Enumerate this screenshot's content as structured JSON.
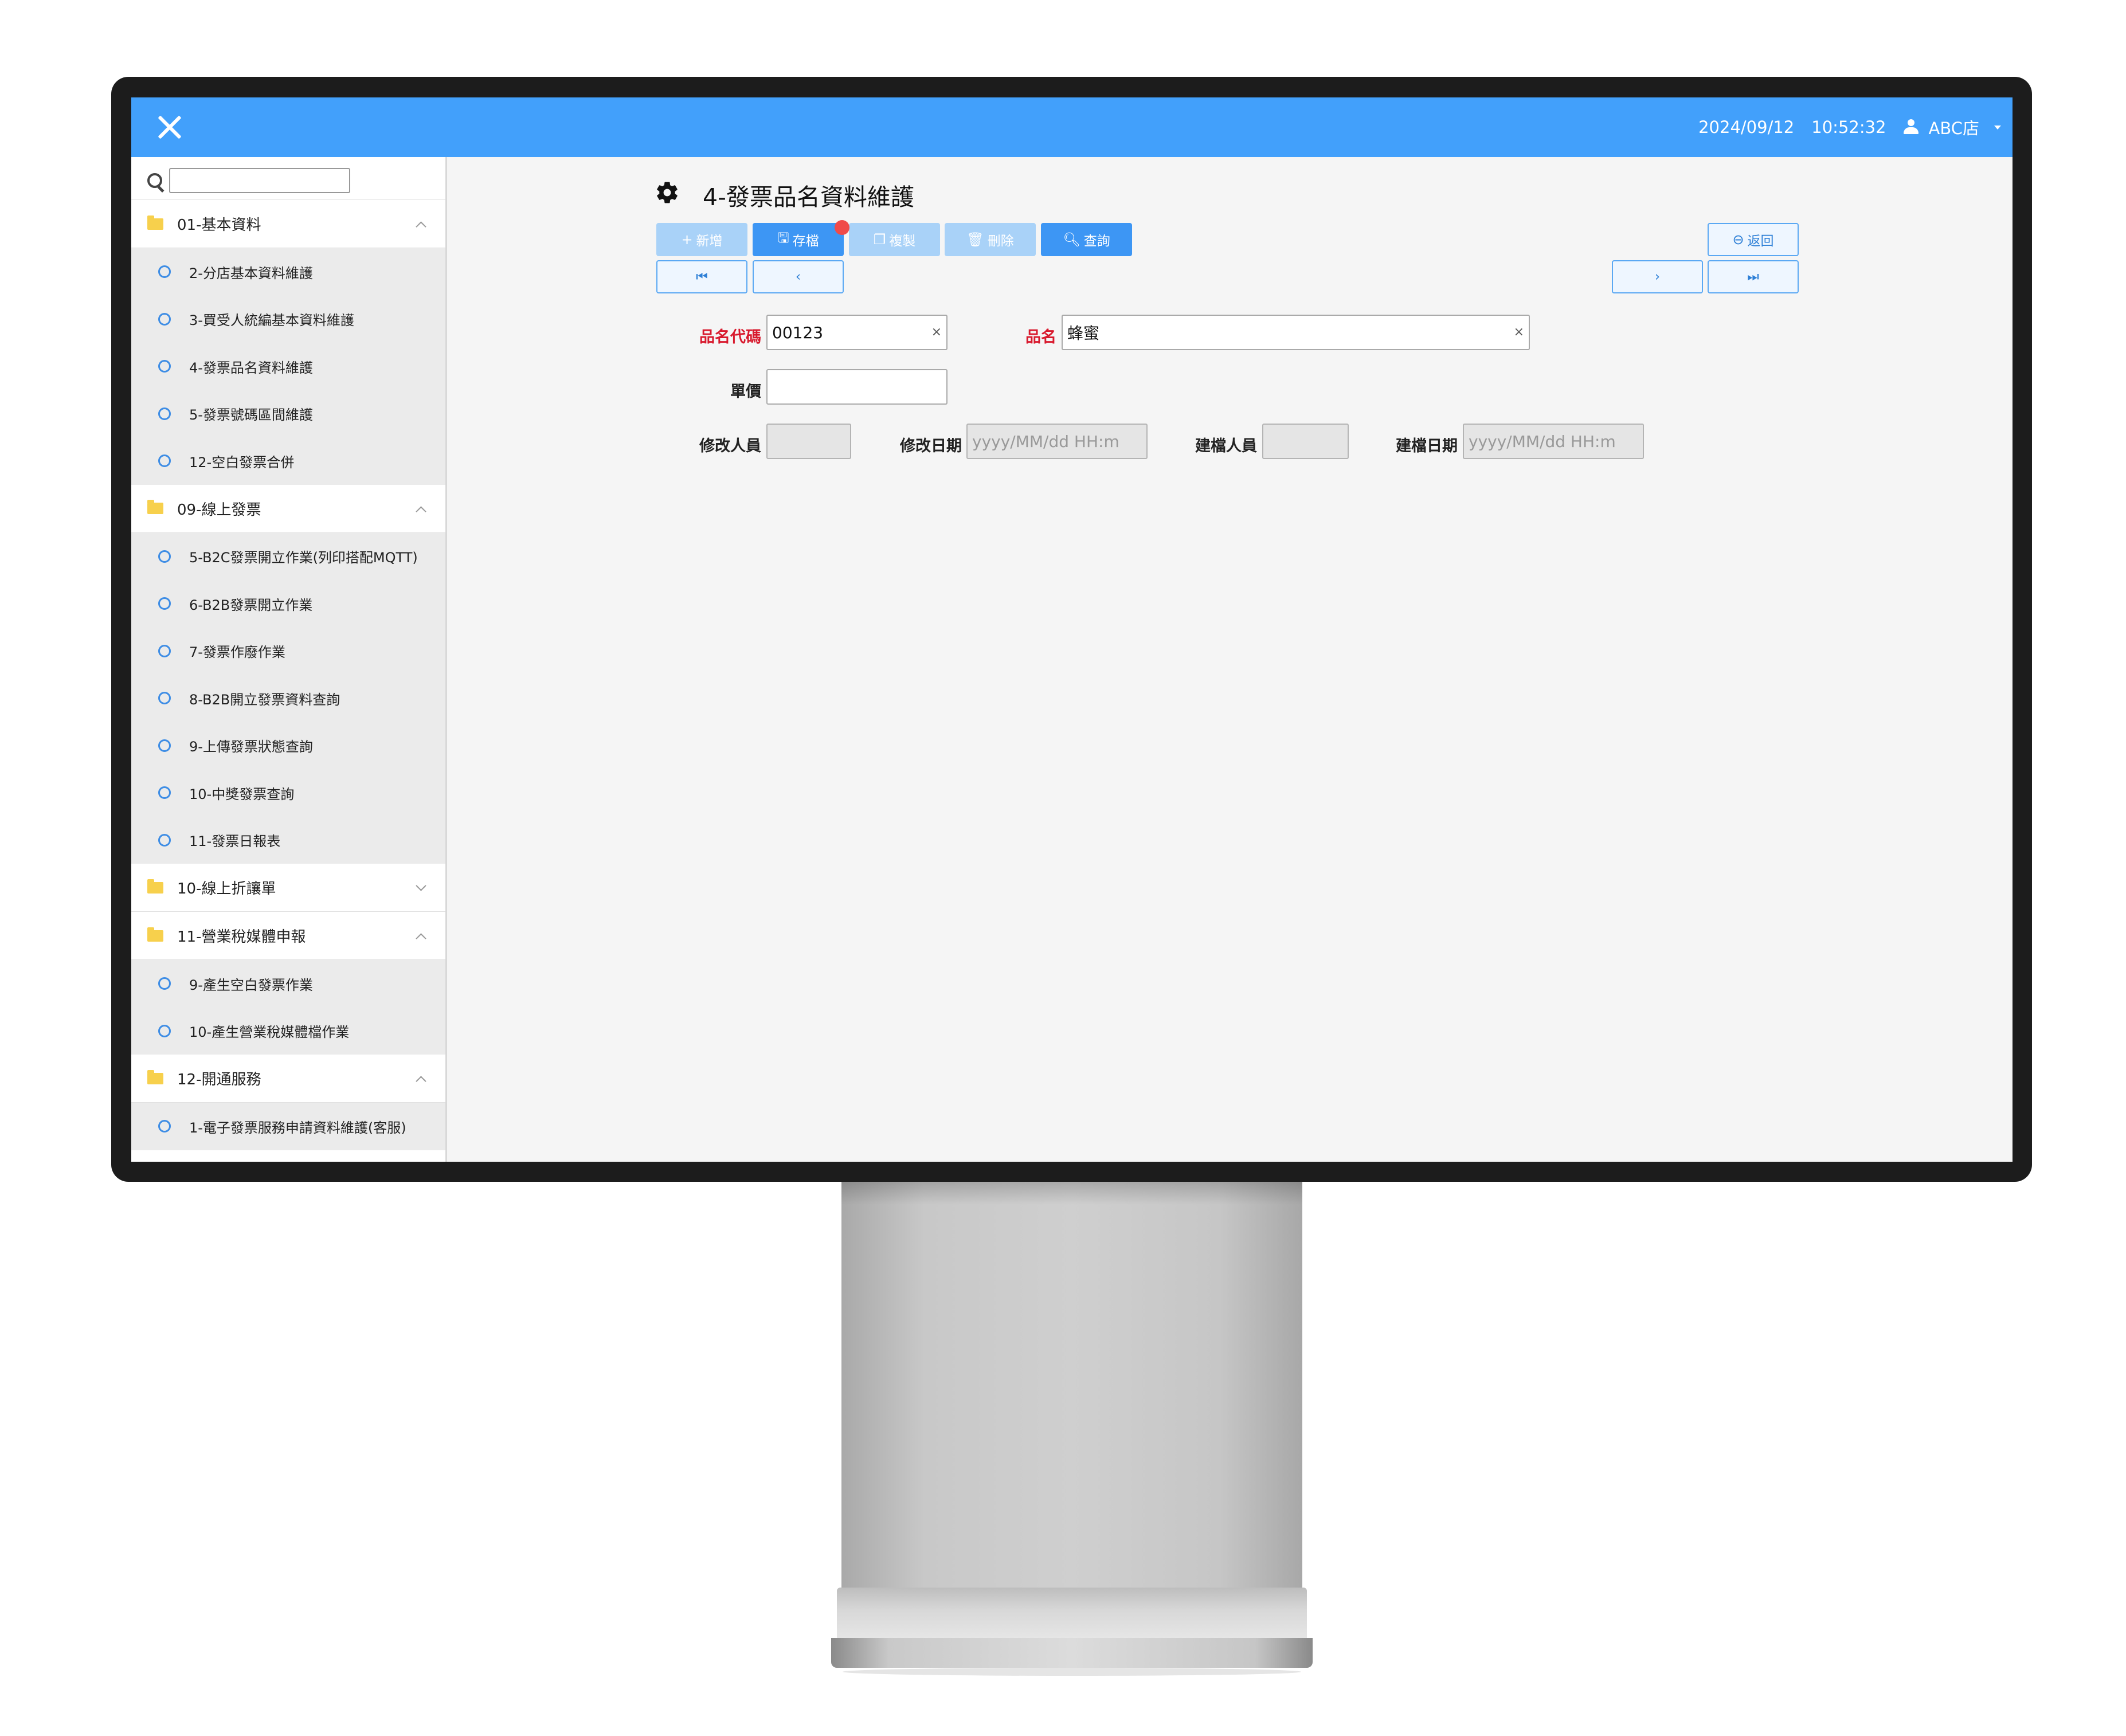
{
  "header": {
    "date": "2024/09/12",
    "time": "10:52:32",
    "store": "ABC店"
  },
  "sidebar": {
    "search_placeholder": "",
    "groups": [
      {
        "label": "01-基本資料",
        "expanded": true,
        "items": [
          "2-分店基本資料維護",
          "3-買受人統編基本資料維護",
          "4-發票品名資料維護",
          "5-發票號碼區間維護",
          "12-空白發票合併"
        ]
      },
      {
        "label": "09-線上發票",
        "expanded": true,
        "items": [
          "5-B2C發票開立作業(列印搭配MQTT)",
          "6-B2B發票開立作業",
          "7-發票作廢作業",
          "8-B2B開立發票資料查詢",
          "9-上傳發票狀態查詢",
          "10-中獎發票查詢",
          "11-發票日報表"
        ]
      },
      {
        "label": "10-線上折讓單",
        "expanded": false,
        "items": []
      },
      {
        "label": "11-營業稅媒體申報",
        "expanded": true,
        "items": [
          "9-產生空白發票作業",
          "10-產生營業稅媒體檔作業"
        ]
      },
      {
        "label": "12-開通服務",
        "expanded": true,
        "items": [
          "1-電子發票服務申請資料維護(客服)"
        ]
      }
    ]
  },
  "main": {
    "title": "4-發票品名資料維護",
    "toolbar": {
      "new": "新增",
      "save": "存檔",
      "copy": "複製",
      "delete": "刪除",
      "query": "查詢",
      "back": "返回"
    },
    "form": {
      "code_label": "品名代碼",
      "code_value": "00123",
      "name_label": "品名",
      "name_value": "蜂蜜",
      "price_label": "單價",
      "price_value": "",
      "modifier_label": "修改人員",
      "modify_date_label": "修改日期",
      "modify_date_placeholder": "yyyy/MM/dd   HH:m",
      "creator_label": "建檔人員",
      "create_date_label": "建檔日期",
      "create_date_placeholder": "yyyy/MM/dd   HH:m"
    }
  },
  "colors": {
    "header": "#42a0fb",
    "button_primary": "#3d96f4",
    "button_disabled": "#a9d2f8",
    "required_label": "#d8192d",
    "badge": "#f04a4a"
  }
}
